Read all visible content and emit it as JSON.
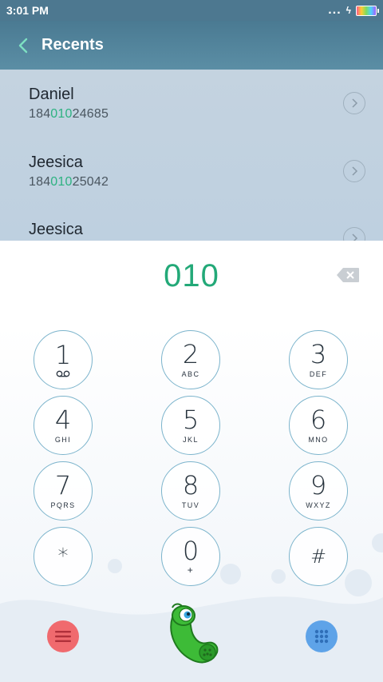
{
  "status_bar": {
    "time": "3:01 PM",
    "dots": "...",
    "bolt": "ϟ"
  },
  "header": {
    "title": "Recents"
  },
  "recents": [
    {
      "name": "Daniel",
      "number_pre": "184",
      "number_match": "010",
      "number_post": "24685"
    },
    {
      "name": "Jeesica",
      "number_pre": "184",
      "number_match": "010",
      "number_post": "25042"
    },
    {
      "name": "Jeesica",
      "number_pre": "",
      "number_match": "",
      "number_post": ""
    }
  ],
  "dialer": {
    "digits": "010"
  },
  "keys": [
    {
      "digit": "1",
      "letters": ""
    },
    {
      "digit": "2",
      "letters": "ABC"
    },
    {
      "digit": "3",
      "letters": "DEF"
    },
    {
      "digit": "4",
      "letters": "GHI"
    },
    {
      "digit": "5",
      "letters": "JKL"
    },
    {
      "digit": "6",
      "letters": "MNO"
    },
    {
      "digit": "7",
      "letters": "PQRS"
    },
    {
      "digit": "8",
      "letters": "TUV"
    },
    {
      "digit": "9",
      "letters": "WXYZ"
    },
    {
      "digit": "*",
      "letters": ""
    },
    {
      "digit": "0",
      "letters": "+"
    },
    {
      "digit": "#",
      "letters": ""
    }
  ],
  "icons": {
    "back": "chevron-left-icon",
    "backspace": "backspace-icon",
    "voicemail": "voicemail-icon",
    "menu": "menu-icon",
    "call": "phone-mascot-icon",
    "keypad_toggle": "keypad-grid-icon"
  },
  "colors": {
    "accent_green": "#23a978",
    "menu_red": "#f06a6e",
    "grid_blue": "#5ea3e8",
    "key_border": "#7cb4cc",
    "header_bg": "#4d7890"
  }
}
